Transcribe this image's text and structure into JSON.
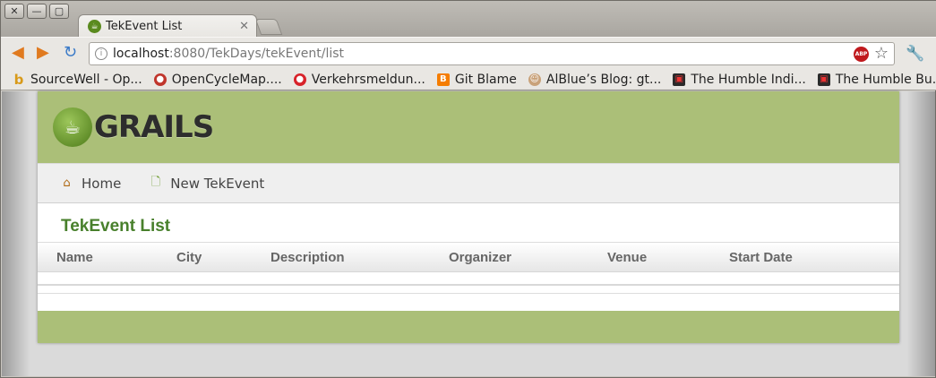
{
  "window": {
    "buttons": [
      "✕",
      "—",
      "▢"
    ]
  },
  "tab": {
    "title": "TekEvent List",
    "close": "✕"
  },
  "toolbar": {
    "url_host": "localhost",
    "url_rest": ":8080/TekDays/tekEvent/list",
    "adblock_label": "ABP"
  },
  "bookmarks": [
    {
      "label": "SourceWell - Op...",
      "icon": "b-icon",
      "color": "#d89a1a"
    },
    {
      "label": "OpenCycleMap....",
      "icon": "cycle-icon",
      "color": "#7a4a2a"
    },
    {
      "label": "Verkehrsmeldun...",
      "icon": "traffic-icon",
      "color": "#d8232a"
    },
    {
      "label": "Git Blame",
      "icon": "blogger-icon",
      "color": "#f57d00"
    },
    {
      "label": "AlBlue’s Blog: gt...",
      "icon": "avatar-icon",
      "color": "#c9a27a"
    },
    {
      "label": "The Humble Indi...",
      "icon": "humble-icon",
      "color": "#2a2a2a"
    },
    {
      "label": "The Humble Bu...",
      "icon": "humble-icon",
      "color": "#2a2a2a"
    }
  ],
  "app": {
    "logo_text": "GRAILS",
    "nav": {
      "home": "Home",
      "new": "New TekEvent"
    },
    "title": "TekEvent List",
    "columns": [
      "Name",
      "City",
      "Description",
      "Organizer",
      "Venue",
      "Start Date"
    ],
    "rows": []
  },
  "colors": {
    "header_green": "#abbf78",
    "title_green": "#48802c"
  }
}
